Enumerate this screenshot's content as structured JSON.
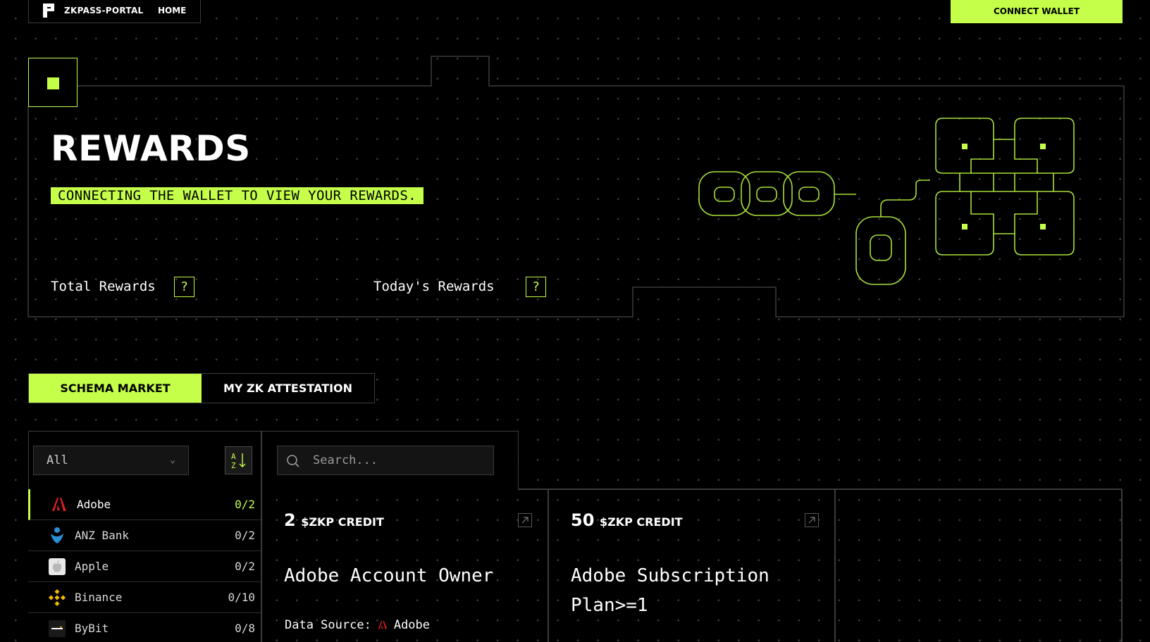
{
  "nav": {
    "brand": "ZKPASS-PORTAL",
    "home": "HOME",
    "connect_wallet": "CONNECT WALLET"
  },
  "rewards": {
    "title": "REWARDS",
    "subtitle": "CONNECTING THE WALLET TO VIEW YOUR REWARDS.",
    "total_label": "Total Rewards",
    "today_label": "Today's Rewards",
    "help_glyph": "?"
  },
  "tabs": {
    "schema_market": "SCHEMA MARKET",
    "my_attestation": "MY ZK ATTESTATION"
  },
  "filter": {
    "category_value": "All",
    "search_placeholder": "Search...",
    "sort_icon": "sort-az-icon"
  },
  "providers": [
    {
      "name": "Adobe",
      "count": "0/2",
      "icon": "adobe-icon",
      "active": true
    },
    {
      "name": "ANZ Bank",
      "count": "0/2",
      "icon": "anz-bank-icon"
    },
    {
      "name": "Apple",
      "count": "0/2",
      "icon": "apple-icon"
    },
    {
      "name": "Binance",
      "count": "0/10",
      "icon": "binance-icon"
    },
    {
      "name": "ByBit",
      "count": "0/8",
      "icon": "bybit-icon"
    }
  ],
  "cards": [
    {
      "credit": "2",
      "unit": "$ZKP CREDIT",
      "title": "Adobe Account Owner",
      "source_label": "Data Source:",
      "source_name": "Adobe"
    },
    {
      "credit": "50",
      "unit": "$ZKP CREDIT",
      "title": "Adobe Subscription Plan>=1"
    }
  ],
  "colors": {
    "accent": "#c5ff4a",
    "background": "#000000",
    "border": "#3c3c3c"
  }
}
